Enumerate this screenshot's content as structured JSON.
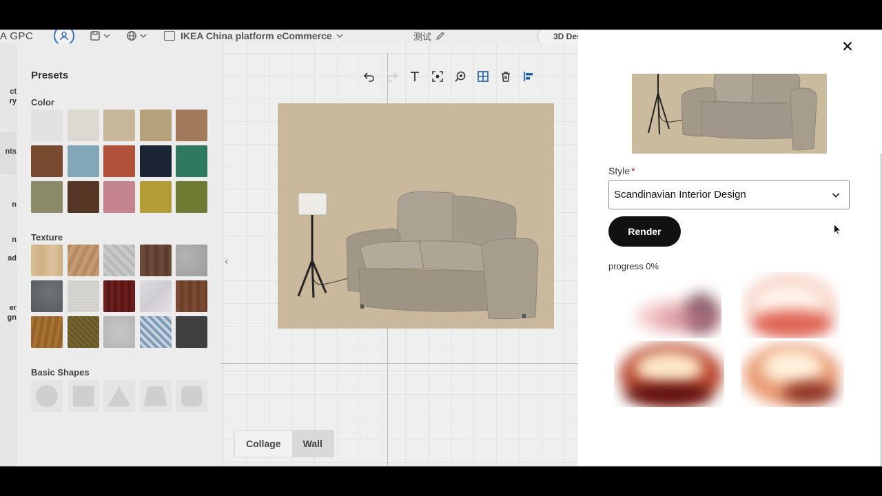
{
  "app": {
    "brand": "A GPC",
    "platform": "IKEA China platform eCommerce",
    "test_label": "测试",
    "design_button": "3D Des"
  },
  "left_rail": {
    "labels": [
      "ct",
      "ry",
      "nts",
      "n",
      "n",
      "ad",
      "er",
      "gn"
    ]
  },
  "presets": {
    "title": "Presets",
    "color_title": "Color",
    "colors": [
      "#e2e2e2",
      "#dcd9d2",
      "#c7b798",
      "#b6a27a",
      "#a47a5c",
      "#7a4a30",
      "#82a7b6",
      "#b2513a",
      "#1a2433",
      "#2f7a5f",
      "#8a8a68",
      "#553524",
      "#c3848f",
      "#b29c33",
      "#6f7a33"
    ],
    "texture_title": "Texture",
    "textures": [
      {
        "name": "light-oak",
        "bg": "linear-gradient(90deg,#d8bf95,#cfb184,#dcc39c,#cdb083)"
      },
      {
        "name": "warm-wood",
        "bg": "repeating-linear-gradient(115deg,#b88a64 0 6px,#c59b74 6px 12px)"
      },
      {
        "name": "herringbone-grey",
        "bg": "repeating-linear-gradient(45deg,#b9b9b9 0 5px,#c9c9c9 5px 10px)"
      },
      {
        "name": "dark-walnut",
        "bg": "repeating-linear-gradient(90deg,#6a4a38 0 7px,#5b3e2f 7px 14px)"
      },
      {
        "name": "stone-grey",
        "bg": "radial-gradient(circle at 30% 40%,#b3b3b3,#9d9d9d)"
      },
      {
        "name": "slate",
        "bg": "radial-gradient(circle at 60% 40%,#6f7378,#55595e)"
      },
      {
        "name": "linen",
        "bg": "repeating-linear-gradient(0deg,#d7d6d2 0 2px,#cfcec9 2px 4px)"
      },
      {
        "name": "mahogany",
        "bg": "repeating-linear-gradient(90deg,#6b1e1e 0 5px,#5a1515 5px 10px)"
      },
      {
        "name": "white-marble",
        "bg": "linear-gradient(135deg,#dedcdf,#cfcdd3,#e3e1e6)"
      },
      {
        "name": "reddish-wood",
        "bg": "repeating-linear-gradient(90deg,#7a4a32 0 6px,#6c3f29 6px 12px)"
      },
      {
        "name": "golden-oak",
        "bg": "repeating-linear-gradient(100deg,#a87330 0 5px,#95622a 5px 10px)"
      },
      {
        "name": "olive-weave",
        "bg": "repeating-linear-gradient(45deg,#76662e 0 3px,#655627 3px 6px)"
      },
      {
        "name": "concrete",
        "bg": "radial-gradient(circle at 50% 50%,#c6c6c6,#b5b5b5)"
      },
      {
        "name": "blue-tile",
        "bg": "repeating-linear-gradient(45deg,#7e9bb5 0 4px,#c7d4df 4px 8px),#7e9bb5"
      },
      {
        "name": "charcoal",
        "bg": "#3f3f3f"
      }
    ],
    "shapes_title": "Basic Shapes"
  },
  "canvas": {
    "modes": [
      "Collage",
      "Wall"
    ],
    "active_mode": "Wall"
  },
  "render_panel": {
    "style_label": "Style",
    "style_required": "*",
    "style_value": "Scandinavian Interior Design",
    "render_button": "Render",
    "progress_text": "progress 0%"
  }
}
